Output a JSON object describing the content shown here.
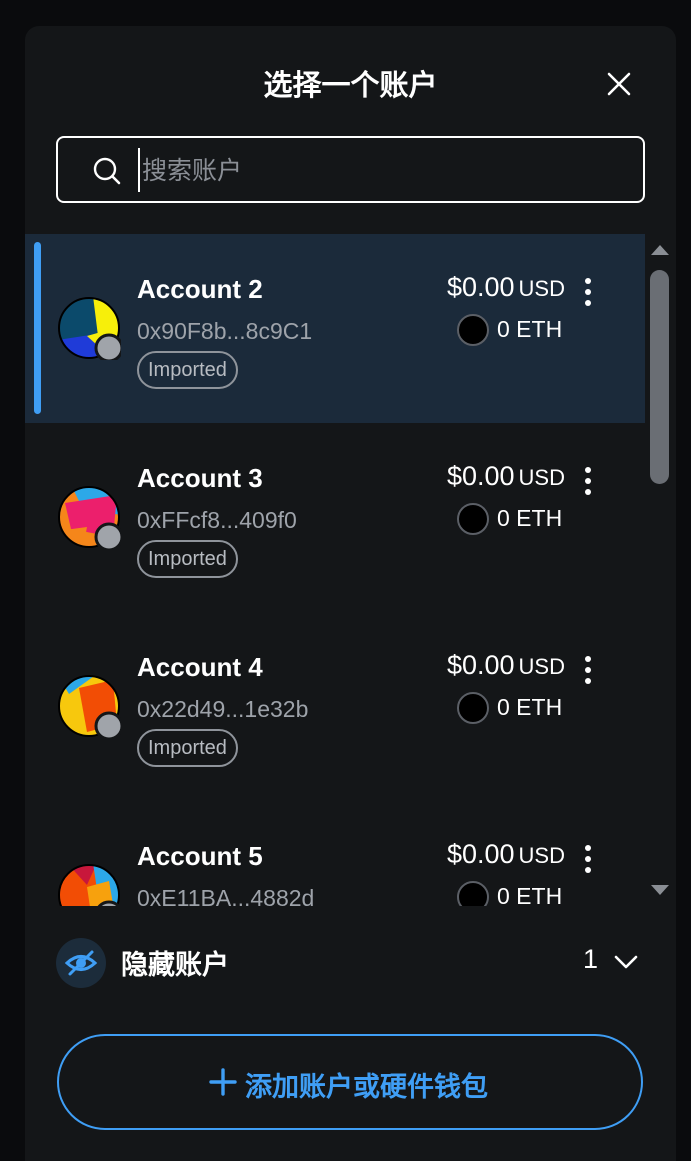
{
  "header": {
    "title": "选择一个账户"
  },
  "search": {
    "placeholder": "搜索账户",
    "value": ""
  },
  "accounts": [
    {
      "name": "Account 2",
      "address": "0x90F8b...8c9C1",
      "tag": "Imported",
      "fiat_value": "$0.00",
      "fiat_currency": "USD",
      "token_amount": "0 ETH",
      "selected": true
    },
    {
      "name": "Account 3",
      "address": "0xFFcf8...409f0",
      "tag": "Imported",
      "fiat_value": "$0.00",
      "fiat_currency": "USD",
      "token_amount": "0 ETH",
      "selected": false
    },
    {
      "name": "Account 4",
      "address": "0x22d49...1e32b",
      "tag": "Imported",
      "fiat_value": "$0.00",
      "fiat_currency": "USD",
      "token_amount": "0 ETH",
      "selected": false
    },
    {
      "name": "Account 5",
      "address": "0xE11BA...4882d",
      "tag": "",
      "fiat_value": "$0.00",
      "fiat_currency": "USD",
      "token_amount": "0 ETH",
      "selected": false
    }
  ],
  "hidden_accounts": {
    "label": "隐藏账户",
    "count": "1"
  },
  "add_button": {
    "label": "添加账户或硬件钱包"
  },
  "colors": {
    "accent": "#3f9ef5",
    "selected_bg": "#1b2a3a",
    "modal_bg": "#141618"
  },
  "icons": [
    "close-icon",
    "search-icon",
    "more-vertical-icon",
    "eth-token-icon",
    "eye-slash-icon",
    "chevron-down-icon",
    "plus-icon"
  ]
}
